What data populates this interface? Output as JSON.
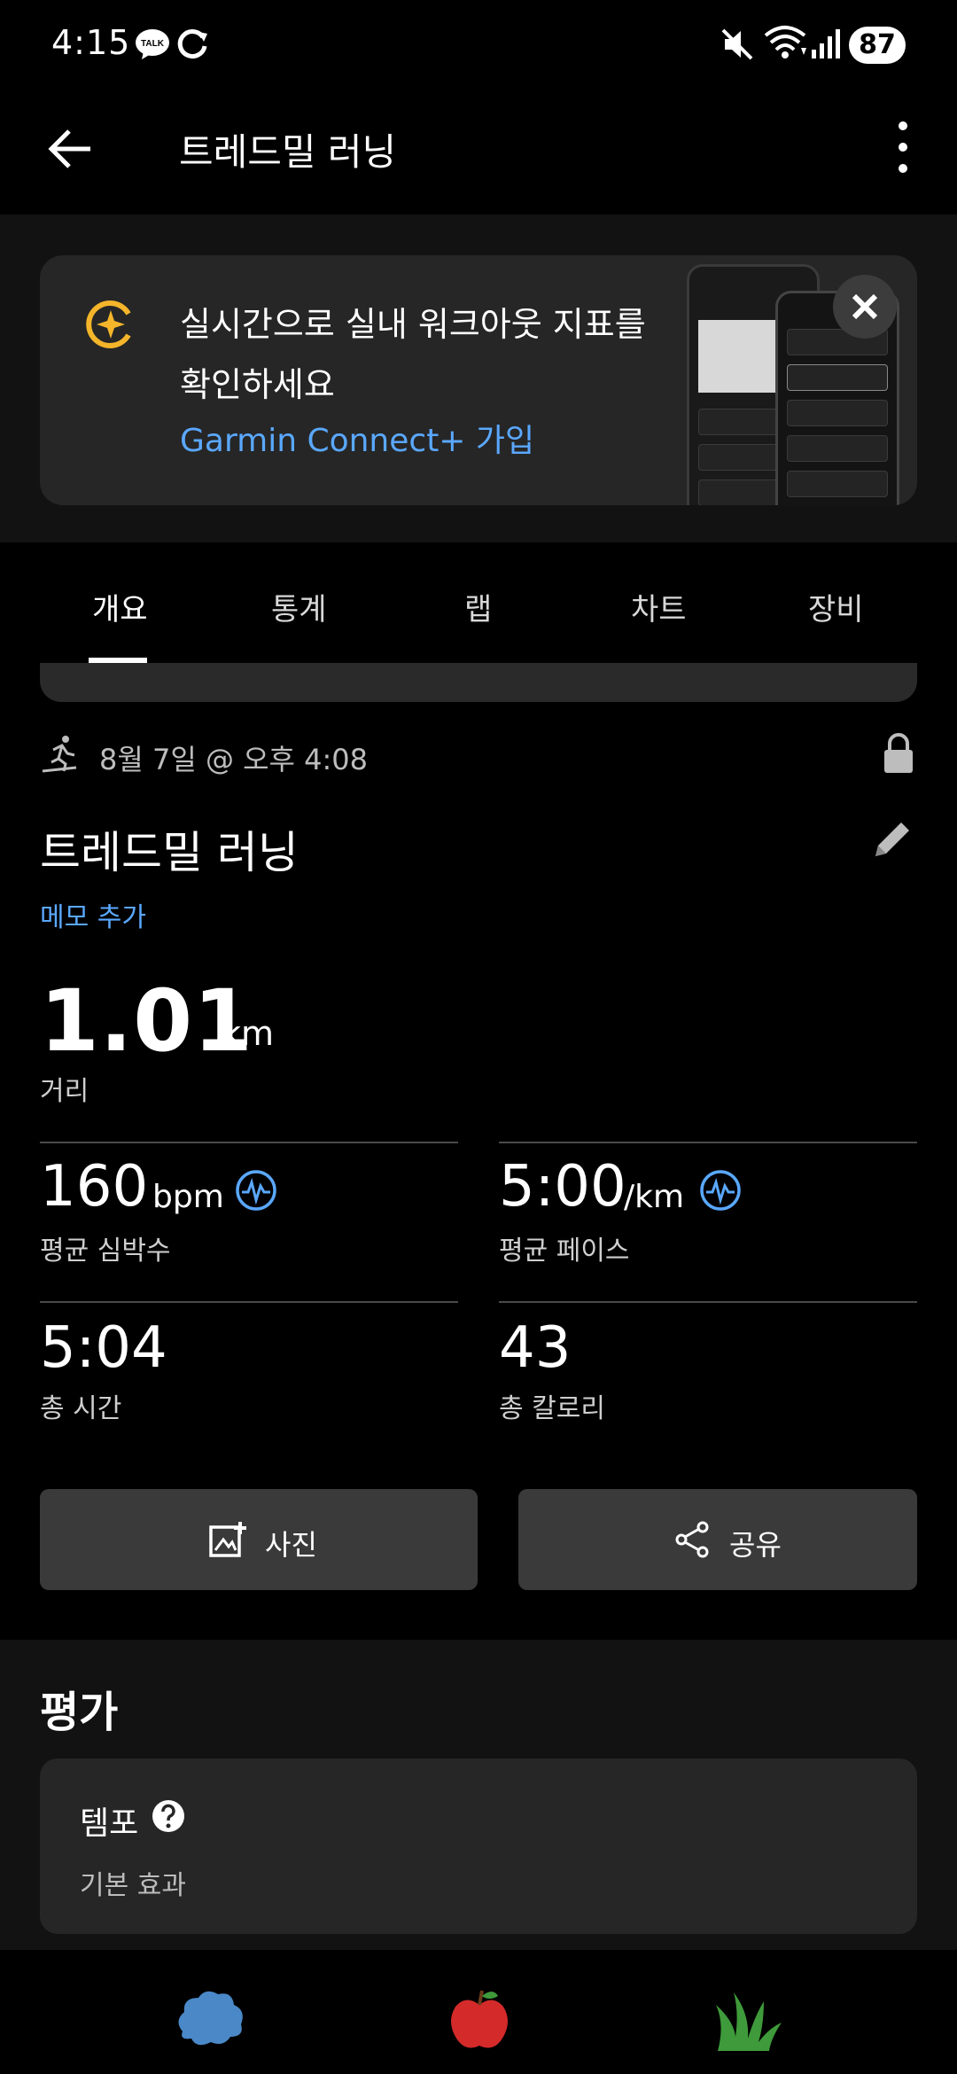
{
  "status_bar": {
    "time": "4:15",
    "battery": "87",
    "talk_badge": "TALK"
  },
  "app_bar": {
    "title": "트레드밀 러닝"
  },
  "promo": {
    "text": "실시간으로 실내 워크아웃 지표를 확인하세요",
    "link": "Garmin Connect+ 가입"
  },
  "tabs": [
    "개요",
    "통계",
    "랩",
    "차트",
    "장비"
  ],
  "activity": {
    "date": "8월 7일 @ 오후 4:08",
    "name": "트레드밀 러닝",
    "memo_link": "메모 추가",
    "distance": {
      "value": "1.01",
      "unit": "km",
      "label": "거리"
    }
  },
  "stats": {
    "heart_rate": {
      "value": "160",
      "unit": "bpm",
      "label": "평균 심박수"
    },
    "pace": {
      "value": "5:00",
      "unit": "/km",
      "label": "평균 페이스"
    },
    "time": {
      "value": "5:04",
      "label": "총 시간"
    },
    "calories": {
      "value": "43",
      "label": "총 칼로리"
    }
  },
  "actions": {
    "photo": "사진",
    "share": "공유"
  },
  "rating": {
    "title": "평가",
    "tempo_label": "템포",
    "tempo_sub": "기본 효과"
  },
  "colors": {
    "accent": "#5aa8ff",
    "connect_gold": "#f5b52a"
  }
}
